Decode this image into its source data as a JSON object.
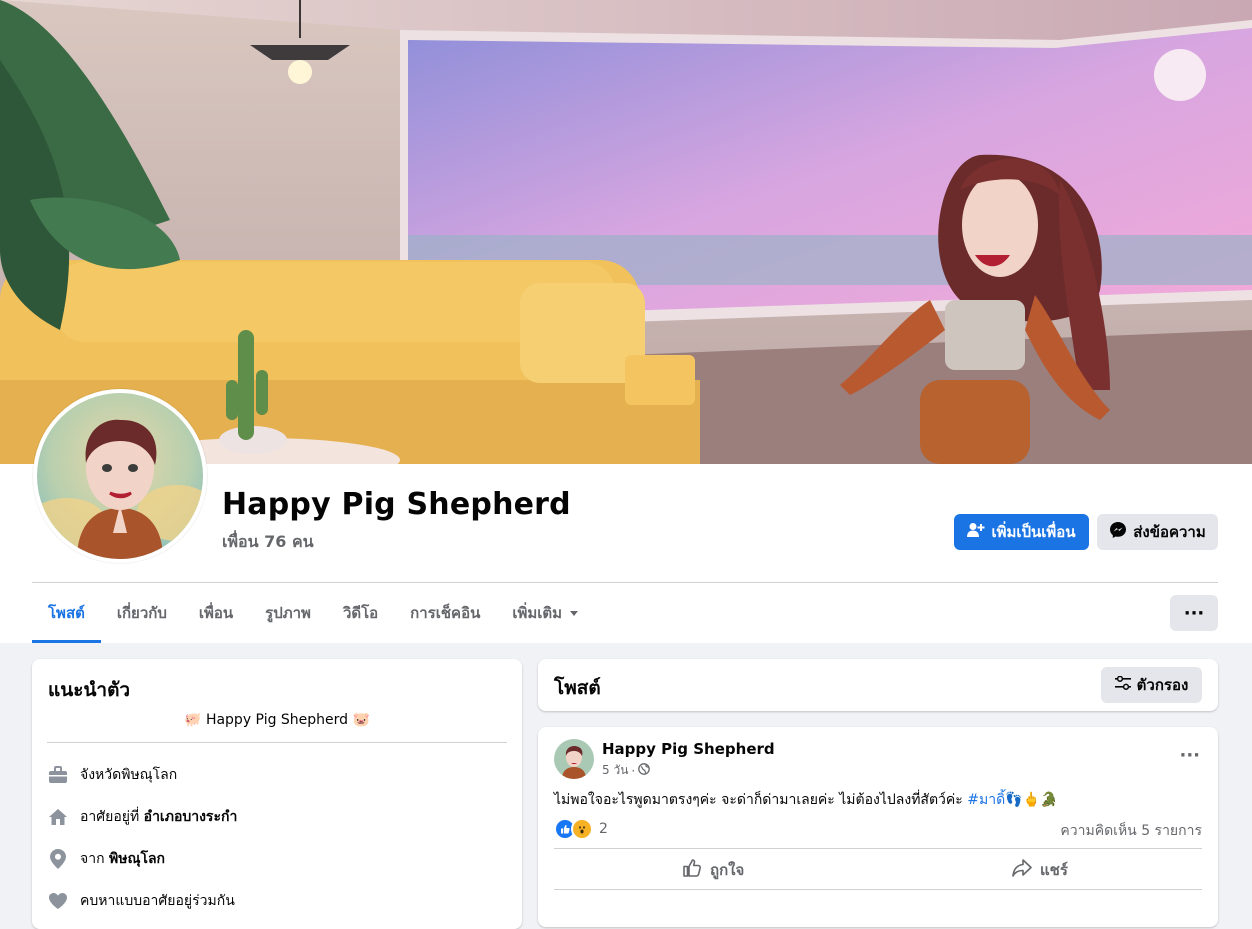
{
  "profile": {
    "name": "Happy Pig Shepherd",
    "friends": "เพื่อน 76 คน"
  },
  "actions": {
    "add_friend": "เพิ่มเป็นเพื่อน",
    "message": "ส่งข้อความ"
  },
  "tabs": [
    {
      "label": "โพสต์",
      "active": true
    },
    {
      "label": "เกี่ยวกับ"
    },
    {
      "label": "เพื่อน"
    },
    {
      "label": "รูปภาพ"
    },
    {
      "label": "วิดีโอ"
    },
    {
      "label": "การเช็คอิน"
    },
    {
      "label": "เพิ่มเติม"
    }
  ],
  "more_button": "···",
  "intro": {
    "title": "แนะนำตัว",
    "bio": "Happy Pig Shepherd",
    "rows": [
      {
        "icon": "briefcase-icon",
        "text": "จังหวัดพิษณุโลก",
        "bold": ""
      },
      {
        "icon": "home-icon",
        "text": "อาศัยอยู่ที่ ",
        "bold": "อำเภอบางระกำ"
      },
      {
        "icon": "location-pin-icon",
        "text": "จาก ",
        "bold": "พิษณุโลก"
      },
      {
        "icon": "heart-icon",
        "text": "คบหาแบบอาศัยอยู่ร่วมกัน",
        "bold": ""
      }
    ]
  },
  "posts_header": {
    "title": "โพสต์",
    "filter": "ตัวกรอง"
  },
  "post": {
    "author": "Happy Pig Shepherd",
    "time": "5 วัน",
    "text": "ไม่พอใจอะไรพูดมาตรงๆค่ะ จะด่าก็ด่ามาเลยค่ะ ไม่ต้องไปลงที่สัตว์ค่ะ ",
    "hashtag": "#มาดิ้",
    "emoji_tail": "👣🖕🐊",
    "reaction_count": "2",
    "comments": "ความคิดเห็น 5 รายการ",
    "like": "ถูกใจ",
    "share": "แชร์"
  },
  "colors": {
    "accent": "#1b74e4",
    "secondary_text": "#65676b",
    "background": "#f0f2f5"
  }
}
